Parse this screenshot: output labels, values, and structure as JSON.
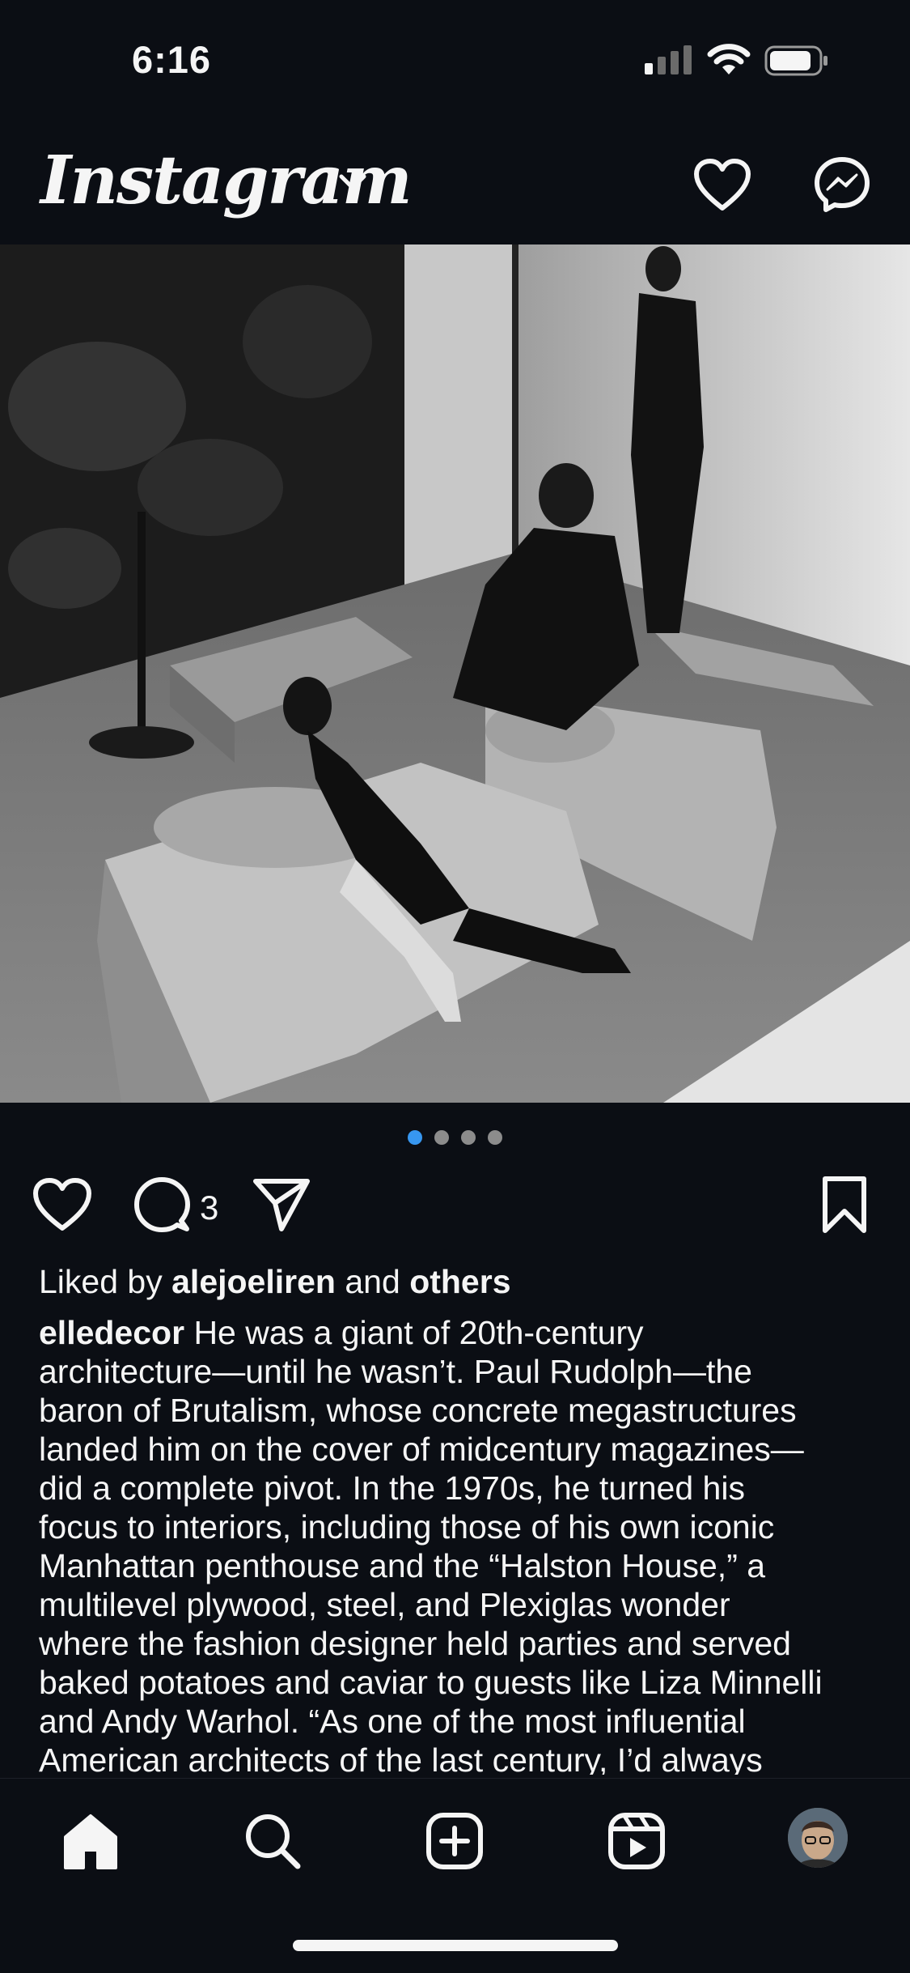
{
  "status_bar": {
    "time": "6:16"
  },
  "header": {
    "logo_text": "Instagram"
  },
  "post": {
    "carousel": {
      "count": 4,
      "active_index": 0
    },
    "comment_count": "3",
    "liked_by_prefix": "Liked by",
    "liked_by_user": "alejoeliren",
    "liked_by_and": "and",
    "liked_by_others": "others",
    "caption_user": "elledecor",
    "caption_lines": [
      " He was a giant of 20th-century",
      "architecture—until he wasn’t. Paul Rudolph—the",
      "baron of Brutalism, whose concrete megastructures",
      "landed him on the cover of midcentury magazines—",
      "did a complete pivot. In the 1970s, he turned his",
      "focus to interiors, including those of his own iconic",
      "Manhattan penthouse and the “Halston House,” a",
      "multilevel plywood, steel, and Plexiglas wonder",
      "where the fashion designer held parties and served",
      "baked potatoes and caviar to guests like Liza Minnelli",
      "and Andy Warhol. “As one of the most influential",
      "American architects of the last century, I’d always"
    ]
  },
  "icons": {
    "header": [
      "chevron-down-icon",
      "heart-icon",
      "messenger-icon"
    ],
    "post": [
      "heart-icon",
      "comment-icon",
      "share-icon",
      "bookmark-icon"
    ],
    "tabbar": [
      "home-icon",
      "search-icon",
      "create-icon",
      "reels-icon",
      "profile-avatar"
    ]
  },
  "colors": {
    "background": "#0b0e14",
    "active_dot": "#3797f0",
    "text": "#f5f5f5"
  }
}
